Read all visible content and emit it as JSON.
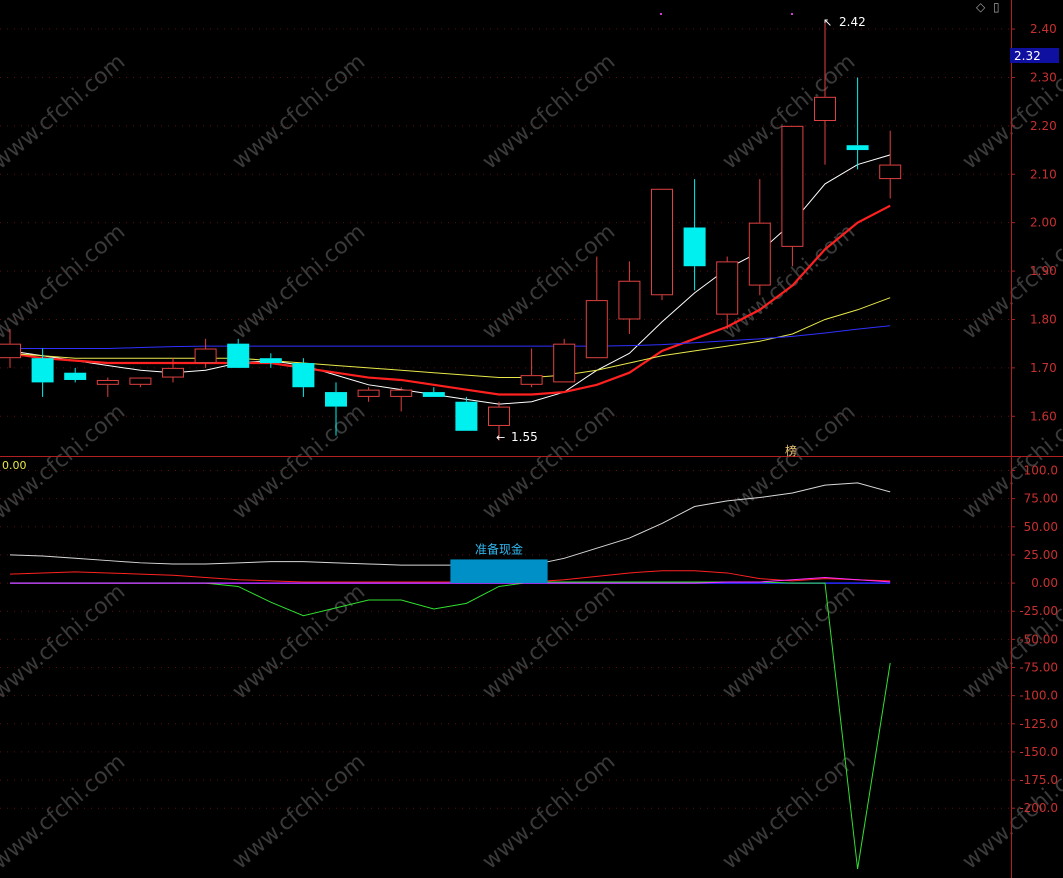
{
  "header": {
    "indicator_value": "0.00",
    "current_price_tag": "2.32"
  },
  "watermark": {
    "text": "www.cfchi.com"
  },
  "colors": {
    "background": "#000000",
    "up": "#e04040",
    "down": "#00f0f0",
    "axis": "#b02020",
    "ma5": "#ffffff",
    "ma10": "#ff2020",
    "ma20": "#e8e84a",
    "ma60": "#3030ff",
    "osc_white": "#d8d8d8",
    "osc_red": "#ff2020",
    "osc_blue": "#2a2aff",
    "osc_green": "#30e030",
    "osc_magenta": "#ff30ff",
    "signal_box": "#0090c8"
  },
  "chart_data": [
    {
      "type": "candlestick",
      "ylim": [
        1.52,
        2.46
      ],
      "yticks": [
        "2.40",
        "2.30",
        "2.20",
        "2.10",
        "2.00",
        "1.90",
        "1.80",
        "1.70",
        "1.60"
      ],
      "grid": true,
      "annotations": {
        "high_label": "2.42",
        "low_label": "1.55",
        "badge_label": "榜"
      },
      "candles": [
        {
          "o": 1.72,
          "h": 1.78,
          "l": 1.7,
          "c": 1.75
        },
        {
          "o": 1.72,
          "h": 1.74,
          "l": 1.64,
          "c": 1.67
        },
        {
          "o": 1.69,
          "h": 1.7,
          "l": 1.67,
          "c": 1.675
        },
        {
          "o": 1.665,
          "h": 1.68,
          "l": 1.64,
          "c": 1.675
        },
        {
          "o": 1.665,
          "h": 1.68,
          "l": 1.66,
          "c": 1.68
        },
        {
          "o": 1.68,
          "h": 1.72,
          "l": 1.67,
          "c": 1.7
        },
        {
          "o": 1.71,
          "h": 1.76,
          "l": 1.7,
          "c": 1.74
        },
        {
          "o": 1.75,
          "h": 1.76,
          "l": 1.7,
          "c": 1.7
        },
        {
          "o": 1.72,
          "h": 1.73,
          "l": 1.7,
          "c": 1.71
        },
        {
          "o": 1.71,
          "h": 1.72,
          "l": 1.64,
          "c": 1.66
        },
        {
          "o": 1.65,
          "h": 1.67,
          "l": 1.56,
          "c": 1.62
        },
        {
          "o": 1.64,
          "h": 1.66,
          "l": 1.63,
          "c": 1.655
        },
        {
          "o": 1.64,
          "h": 1.66,
          "l": 1.61,
          "c": 1.655
        },
        {
          "o": 1.65,
          "h": 1.66,
          "l": 1.64,
          "c": 1.64
        },
        {
          "o": 1.63,
          "h": 1.64,
          "l": 1.57,
          "c": 1.57
        },
        {
          "o": 1.58,
          "h": 1.63,
          "l": 1.55,
          "c": 1.62
        },
        {
          "o": 1.665,
          "h": 1.74,
          "l": 1.66,
          "c": 1.685
        },
        {
          "o": 1.67,
          "h": 1.76,
          "l": 1.67,
          "c": 1.75
        },
        {
          "o": 1.72,
          "h": 1.93,
          "l": 1.72,
          "c": 1.84
        },
        {
          "o": 1.8,
          "h": 1.92,
          "l": 1.77,
          "c": 1.88
        },
        {
          "o": 1.85,
          "h": 2.07,
          "l": 1.84,
          "c": 2.07
        },
        {
          "o": 1.99,
          "h": 2.09,
          "l": 1.86,
          "c": 1.91
        },
        {
          "o": 1.81,
          "h": 1.93,
          "l": 1.78,
          "c": 1.92
        },
        {
          "o": 1.87,
          "h": 2.09,
          "l": 1.85,
          "c": 2.0
        },
        {
          "o": 1.95,
          "h": 2.2,
          "l": 1.91,
          "c": 2.2
        },
        {
          "o": 2.21,
          "h": 2.42,
          "l": 2.12,
          "c": 2.26
        },
        {
          "o": 2.16,
          "h": 2.3,
          "l": 2.11,
          "c": 2.15
        },
        {
          "o": 2.09,
          "h": 2.19,
          "l": 2.05,
          "c": 2.12
        }
      ],
      "series": [
        {
          "name": "MA5",
          "values": [
            1.735,
            1.725,
            1.715,
            1.705,
            1.695,
            1.69,
            1.695,
            1.71,
            1.715,
            1.705,
            1.685,
            1.665,
            1.655,
            1.645,
            1.635,
            1.625,
            1.63,
            1.65,
            1.695,
            1.73,
            1.795,
            1.855,
            1.905,
            1.94,
            2.0,
            2.08,
            2.12,
            2.14
          ]
        },
        {
          "name": "MA10",
          "values": [
            1.73,
            1.72,
            1.715,
            1.71,
            1.71,
            1.71,
            1.71,
            1.71,
            1.71,
            1.7,
            1.69,
            1.68,
            1.675,
            1.665,
            1.655,
            1.645,
            1.645,
            1.65,
            1.665,
            1.69,
            1.735,
            1.76,
            1.785,
            1.82,
            1.87,
            1.945,
            2.0,
            2.035
          ]
        },
        {
          "name": "MA20",
          "values": [
            1.73,
            1.725,
            1.72,
            1.72,
            1.72,
            1.72,
            1.72,
            1.72,
            1.715,
            1.71,
            1.705,
            1.7,
            1.695,
            1.69,
            1.685,
            1.68,
            1.68,
            1.685,
            1.695,
            1.71,
            1.725,
            1.735,
            1.745,
            1.755,
            1.77,
            1.8,
            1.82,
            1.845
          ]
        },
        {
          "name": "MA60",
          "values": [
            1.74,
            1.74,
            1.74,
            1.74,
            1.742,
            1.744,
            1.745,
            1.745,
            1.745,
            1.745,
            1.745,
            1.745,
            1.745,
            1.745,
            1.745,
            1.745,
            1.745,
            1.745,
            1.745,
            1.746,
            1.748,
            1.752,
            1.756,
            1.76,
            1.765,
            1.772,
            1.78,
            1.787
          ]
        }
      ]
    },
    {
      "type": "line",
      "ylim": [
        -262,
        112
      ],
      "yticks": [
        "100.0",
        "75.00",
        "50.00",
        "25.00",
        "0.00",
        "-25.00",
        "-50.00",
        "-75.00",
        "-100.0",
        "-125.0",
        "-150.0",
        "-175.0",
        "-200.0"
      ],
      "grid": true,
      "annotations": {
        "signal_label": "准备现金",
        "signal_low": 0,
        "signal_high": 21,
        "signal_from": 14,
        "signal_to": 16
      },
      "series": [
        {
          "name": "white",
          "values": [
            25,
            24,
            22,
            20,
            18,
            17,
            17,
            18,
            19,
            19,
            18,
            17,
            16,
            16,
            16,
            16,
            16,
            22,
            31,
            40,
            53,
            68,
            73,
            76,
            80,
            87,
            89,
            81
          ]
        },
        {
          "name": "red",
          "values": [
            8,
            9,
            10,
            9,
            8,
            7,
            5,
            3,
            2,
            1,
            1,
            1,
            1,
            1,
            1,
            1,
            1,
            3,
            6,
            9,
            11,
            11,
            9,
            4,
            2,
            4,
            3,
            2
          ]
        },
        {
          "name": "blue",
          "values": [
            0,
            0,
            0,
            0,
            0,
            0,
            0,
            0,
            0,
            0,
            0,
            0,
            0,
            0,
            0,
            0,
            0,
            0,
            0,
            0,
            0,
            0,
            0,
            0,
            0,
            0,
            0,
            0
          ]
        },
        {
          "name": "green",
          "values": [
            0,
            0,
            0,
            0,
            0,
            0,
            0,
            -3,
            -17,
            -29,
            -22,
            -15,
            -15,
            -23,
            -18,
            -3,
            1,
            1,
            1,
            1,
            1,
            1,
            1,
            1,
            0,
            0,
            -254,
            -71
          ]
        },
        {
          "name": "magenta",
          "values": [
            0,
            0,
            0,
            0,
            0,
            0,
            0,
            0,
            0,
            0,
            0,
            0,
            0,
            0,
            0,
            0,
            0,
            0,
            0,
            0,
            0,
            0,
            1,
            1,
            3,
            5,
            3,
            1
          ]
        }
      ]
    }
  ]
}
